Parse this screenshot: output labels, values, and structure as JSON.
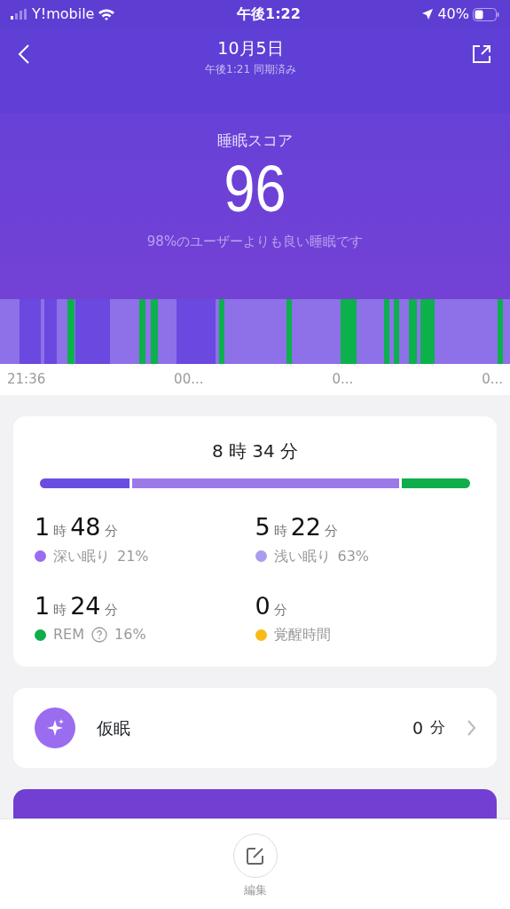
{
  "status_bar": {
    "carrier": "Y!mobile",
    "time": "午後1:22",
    "battery": "40%"
  },
  "header": {
    "title": "10月5日",
    "subtitle": "午後1:21 同期済み"
  },
  "score": {
    "label": "睡眠スコア",
    "value": "96",
    "comment": "98%のユーザーよりも良い睡眠です"
  },
  "timeline_labels": [
    "21:36",
    "00...",
    "0...",
    "0..."
  ],
  "summary": {
    "total_hours": "8",
    "hours_unit": "時",
    "total_minutes": "34",
    "minutes_unit": "分",
    "stages": [
      {
        "hours": "1",
        "hours_unit": "時",
        "minutes": "48",
        "minutes_unit": "分",
        "name": "深い眠り",
        "percent": "21%",
        "color": "#9a6cf0",
        "help": false
      },
      {
        "hours": "5",
        "hours_unit": "時",
        "minutes": "22",
        "minutes_unit": "分",
        "name": "浅い眠り",
        "percent": "63%",
        "color": "#a99cf0",
        "help": false
      },
      {
        "hours": "1",
        "hours_unit": "時",
        "minutes": "24",
        "minutes_unit": "分",
        "name": "REM",
        "percent": "16%",
        "color": "#0fae4b",
        "help": true
      },
      {
        "minutes": "0",
        "minutes_unit": "分",
        "name": "覚醒時間",
        "color": "#fbb917",
        "help": false
      }
    ]
  },
  "nap": {
    "label": "仮眠",
    "value": "0",
    "unit": "分"
  },
  "bottom_bar": {
    "edit_label": "編集"
  }
}
